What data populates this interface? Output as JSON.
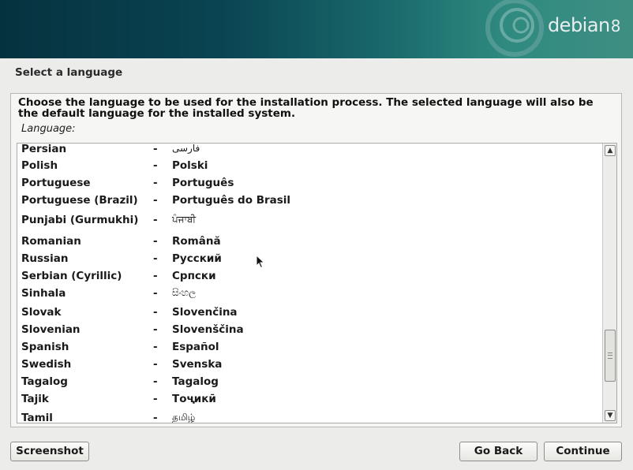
{
  "header": {
    "brand": "debian",
    "version": "8"
  },
  "step_title": "Select a language",
  "instructions": "Choose the language to be used for the installation process. The selected language will also be the default language for the installed system.",
  "field_label": "Language:",
  "languages": [
    {
      "english": "Persian",
      "dash": "-",
      "native": "فارسی"
    },
    {
      "english": "Polish",
      "dash": "-",
      "native": "Polski"
    },
    {
      "english": "Portuguese",
      "dash": "-",
      "native": "Português"
    },
    {
      "english": "Portuguese (Brazil)",
      "dash": "-",
      "native": "Português do Brasil"
    },
    {
      "english": "Punjabi (Gurmukhi)",
      "dash": "-",
      "native": "ਪੰਜਾਬੀ"
    },
    {
      "english": "Romanian",
      "dash": "-",
      "native": "Română"
    },
    {
      "english": "Russian",
      "dash": "-",
      "native": "Русский"
    },
    {
      "english": "Serbian (Cyrillic)",
      "dash": "-",
      "native": "Српски"
    },
    {
      "english": "Sinhala",
      "dash": "-",
      "native": "සිංහල"
    },
    {
      "english": "Slovak",
      "dash": "-",
      "native": "Slovenčina"
    },
    {
      "english": "Slovenian",
      "dash": "-",
      "native": "Slovenščina"
    },
    {
      "english": "Spanish",
      "dash": "-",
      "native": "Español"
    },
    {
      "english": "Swedish",
      "dash": "-",
      "native": "Svenska"
    },
    {
      "english": "Tagalog",
      "dash": "-",
      "native": "Tagalog"
    },
    {
      "english": "Tajik",
      "dash": "-",
      "native": "Тоҷикӣ"
    },
    {
      "english": "Tamil",
      "dash": "-",
      "native": "தமிழ்"
    }
  ],
  "scrollbar": {
    "up_arrow": "▲",
    "down_arrow": "▼",
    "up_icon": "scroll-up-arrow-icon",
    "down_icon": "scroll-down-arrow-icon"
  },
  "buttons": {
    "screenshot": "Screenshot",
    "go_back": "Go Back",
    "continue": "Continue"
  },
  "colors": {
    "banner_dark": "#06323f",
    "banner_light": "#3f8e82",
    "background": "#ececea"
  }
}
